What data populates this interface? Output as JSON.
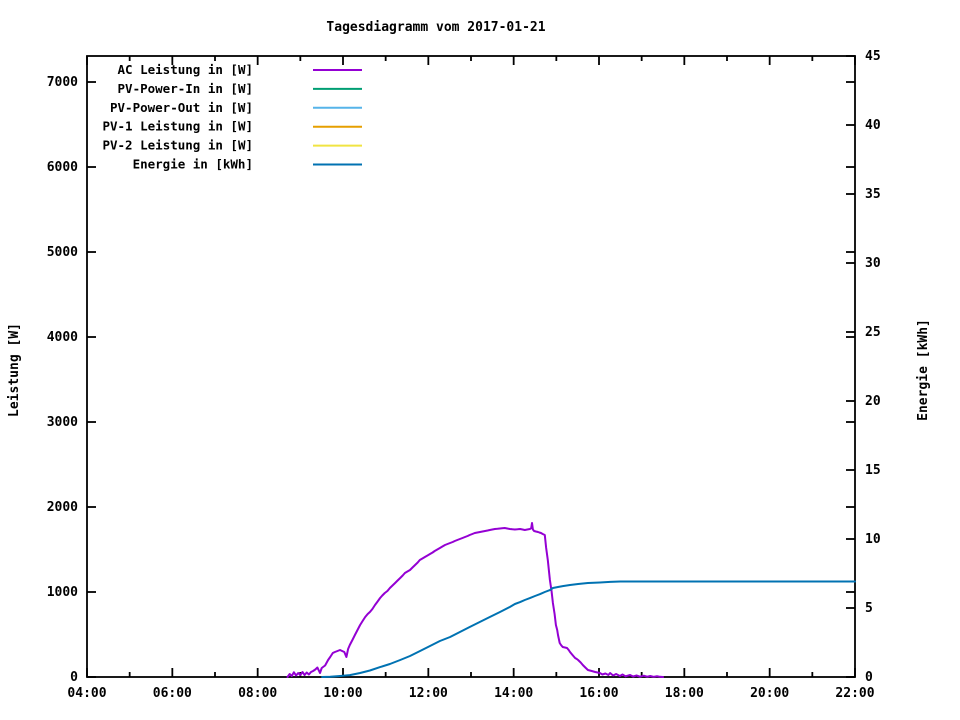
{
  "window": {
    "title": "Tagesdiagramm vom 2017-01-21"
  },
  "colors": {
    "background": "#ffffff",
    "axis": "#000000",
    "text": "#000000"
  },
  "chart_data": {
    "type": "line",
    "title": "Tagesdiagramm vom 2017-01-21",
    "grid": false,
    "legend_position": "top-left-inside",
    "x_axis": {
      "label": "",
      "range_hours": [
        4,
        22
      ],
      "major_tick_hours": [
        4,
        6,
        8,
        10,
        12,
        14,
        16,
        18,
        20,
        22
      ],
      "major_tick_labels": [
        "04:00",
        "06:00",
        "08:00",
        "10:00",
        "12:00",
        "14:00",
        "16:00",
        "18:00",
        "20:00",
        "22:00"
      ],
      "minor_tick_hours": [
        5,
        7,
        9,
        11,
        13,
        15,
        17,
        19,
        21
      ]
    },
    "y_left_axis": {
      "label": "Leistung [W]",
      "range": [
        0,
        7306
      ],
      "tick_values": [
        0,
        1000,
        2000,
        3000,
        4000,
        5000,
        6000,
        7000
      ],
      "tick_labels": [
        "0",
        "1000",
        "2000",
        "3000",
        "4000",
        "5000",
        "6000",
        "7000"
      ]
    },
    "y_right_axis": {
      "label": "Energie [kWh]",
      "range": [
        0,
        45
      ],
      "tick_values": [
        0,
        5,
        10,
        15,
        20,
        25,
        30,
        35,
        40,
        45
      ],
      "tick_labels": [
        "0",
        "5",
        "10",
        "15",
        "20",
        "25",
        "30",
        "35",
        "40",
        "45"
      ]
    },
    "series": [
      {
        "name": "AC Leistung in [W]",
        "color": "#9400d3",
        "axis": "left",
        "points": [
          [
            8.7,
            0
          ],
          [
            8.75,
            35
          ],
          [
            8.8,
            12
          ],
          [
            8.85,
            55
          ],
          [
            8.9,
            18
          ],
          [
            8.95,
            47
          ],
          [
            9.0,
            24
          ],
          [
            9.05,
            59
          ],
          [
            9.1,
            24
          ],
          [
            9.15,
            53
          ],
          [
            9.2,
            29
          ],
          [
            9.25,
            59
          ],
          [
            9.3,
            71
          ],
          [
            9.35,
            88
          ],
          [
            9.4,
            112
          ],
          [
            9.46,
            47
          ],
          [
            9.5,
            106
          ],
          [
            9.58,
            135
          ],
          [
            9.65,
            200
          ],
          [
            9.7,
            235
          ],
          [
            9.76,
            282
          ],
          [
            9.81,
            294
          ],
          [
            9.87,
            306
          ],
          [
            9.93,
            318
          ],
          [
            9.98,
            306
          ],
          [
            10.03,
            294
          ],
          [
            10.08,
            235
          ],
          [
            10.12,
            330
          ],
          [
            10.16,
            376
          ],
          [
            10.22,
            435
          ],
          [
            10.28,
            494
          ],
          [
            10.34,
            553
          ],
          [
            10.4,
            612
          ],
          [
            10.46,
            659
          ],
          [
            10.52,
            706
          ],
          [
            10.58,
            741
          ],
          [
            10.63,
            765
          ],
          [
            10.69,
            800
          ],
          [
            10.75,
            847
          ],
          [
            10.81,
            888
          ],
          [
            10.87,
            929
          ],
          [
            10.92,
            959
          ],
          [
            10.98,
            988
          ],
          [
            11.04,
            1012
          ],
          [
            11.1,
            1047
          ],
          [
            11.16,
            1076
          ],
          [
            11.22,
            1106
          ],
          [
            11.28,
            1135
          ],
          [
            11.34,
            1165
          ],
          [
            11.4,
            1194
          ],
          [
            11.45,
            1224
          ],
          [
            11.51,
            1241
          ],
          [
            11.57,
            1259
          ],
          [
            11.63,
            1288
          ],
          [
            11.69,
            1318
          ],
          [
            11.75,
            1347
          ],
          [
            11.8,
            1376
          ],
          [
            11.86,
            1394
          ],
          [
            11.92,
            1412
          ],
          [
            11.98,
            1429
          ],
          [
            12.04,
            1447
          ],
          [
            12.1,
            1465
          ],
          [
            12.15,
            1482
          ],
          [
            12.21,
            1500
          ],
          [
            12.27,
            1518
          ],
          [
            12.33,
            1535
          ],
          [
            12.39,
            1553
          ],
          [
            12.45,
            1565
          ],
          [
            12.51,
            1576
          ],
          [
            12.57,
            1588
          ],
          [
            12.62,
            1600
          ],
          [
            12.68,
            1612
          ],
          [
            12.74,
            1624
          ],
          [
            12.8,
            1635
          ],
          [
            12.86,
            1647
          ],
          [
            12.92,
            1659
          ],
          [
            12.97,
            1671
          ],
          [
            13.03,
            1682
          ],
          [
            13.09,
            1694
          ],
          [
            13.15,
            1700
          ],
          [
            13.21,
            1706
          ],
          [
            13.27,
            1712
          ],
          [
            13.33,
            1718
          ],
          [
            13.39,
            1724
          ],
          [
            13.44,
            1729
          ],
          [
            13.5,
            1735
          ],
          [
            13.56,
            1741
          ],
          [
            13.62,
            1744
          ],
          [
            13.68,
            1747
          ],
          [
            13.73,
            1750
          ],
          [
            13.79,
            1753
          ],
          [
            13.85,
            1747
          ],
          [
            13.91,
            1741
          ],
          [
            13.97,
            1738
          ],
          [
            14.03,
            1735
          ],
          [
            14.09,
            1738
          ],
          [
            14.15,
            1741
          ],
          [
            14.21,
            1735
          ],
          [
            14.26,
            1729
          ],
          [
            14.32,
            1735
          ],
          [
            14.38,
            1741
          ],
          [
            14.41,
            1750
          ],
          [
            14.43,
            1812
          ],
          [
            14.45,
            1735
          ],
          [
            14.48,
            1718
          ],
          [
            14.52,
            1712
          ],
          [
            14.57,
            1706
          ],
          [
            14.6,
            1700
          ],
          [
            14.64,
            1694
          ],
          [
            14.68,
            1682
          ],
          [
            14.73,
            1671
          ],
          [
            14.76,
            1524
          ],
          [
            14.8,
            1376
          ],
          [
            14.85,
            1141
          ],
          [
            14.89,
            1006
          ],
          [
            14.92,
            871
          ],
          [
            14.96,
            741
          ],
          [
            14.99,
            612
          ],
          [
            15.02,
            553
          ],
          [
            15.04,
            494
          ],
          [
            15.08,
            400
          ],
          [
            15.11,
            376
          ],
          [
            15.15,
            353
          ],
          [
            15.2,
            347
          ],
          [
            15.25,
            341
          ],
          [
            15.29,
            318
          ],
          [
            15.32,
            294
          ],
          [
            15.38,
            259
          ],
          [
            15.44,
            224
          ],
          [
            15.48,
            212
          ],
          [
            15.51,
            200
          ],
          [
            15.57,
            171
          ],
          [
            15.62,
            141
          ],
          [
            15.68,
            112
          ],
          [
            15.74,
            82
          ],
          [
            15.83,
            71
          ],
          [
            15.91,
            59
          ],
          [
            16.02,
            47
          ],
          [
            16.08,
            29
          ],
          [
            16.15,
            41
          ],
          [
            16.22,
            24
          ],
          [
            16.26,
            47
          ],
          [
            16.33,
            18
          ],
          [
            16.4,
            35
          ],
          [
            16.49,
            12
          ],
          [
            16.55,
            29
          ],
          [
            16.62,
            8
          ],
          [
            16.73,
            24
          ],
          [
            16.8,
            6
          ],
          [
            16.88,
            18
          ],
          [
            16.96,
            4
          ],
          [
            17.05,
            15
          ],
          [
            17.13,
            4
          ],
          [
            17.2,
            12
          ],
          [
            17.28,
            2
          ],
          [
            17.36,
            9
          ],
          [
            17.43,
            2
          ],
          [
            17.5,
            0
          ]
        ]
      },
      {
        "name": "PV-Power-In in [W]",
        "color": "#009e73",
        "axis": "left",
        "points": []
      },
      {
        "name": "PV-Power-Out in [W]",
        "color": "#56b4e9",
        "axis": "left",
        "points": []
      },
      {
        "name": "PV-1 Leistung in [W]",
        "color": "#e69f00",
        "axis": "left",
        "points": []
      },
      {
        "name": "PV-2 Leistung in [W]",
        "color": "#f0e442",
        "axis": "left",
        "points": []
      },
      {
        "name": "Energie in [kWh]",
        "color": "#0072b2",
        "axis": "right",
        "points": [
          [
            9.51,
            0.0
          ],
          [
            9.7,
            0.02
          ],
          [
            9.93,
            0.07
          ],
          [
            10.16,
            0.14
          ],
          [
            10.4,
            0.29
          ],
          [
            10.63,
            0.47
          ],
          [
            10.87,
            0.72
          ],
          [
            11.1,
            0.94
          ],
          [
            11.34,
            1.23
          ],
          [
            11.57,
            1.52
          ],
          [
            11.8,
            1.88
          ],
          [
            12.04,
            2.25
          ],
          [
            12.27,
            2.61
          ],
          [
            12.51,
            2.9
          ],
          [
            12.74,
            3.26
          ],
          [
            12.97,
            3.62
          ],
          [
            13.21,
            3.99
          ],
          [
            13.44,
            4.35
          ],
          [
            13.68,
            4.71
          ],
          [
            13.91,
            5.07
          ],
          [
            14.03,
            5.29
          ],
          [
            14.15,
            5.43
          ],
          [
            14.26,
            5.58
          ],
          [
            14.38,
            5.72
          ],
          [
            14.5,
            5.87
          ],
          [
            14.62,
            6.01
          ],
          [
            14.73,
            6.16
          ],
          [
            14.85,
            6.3
          ],
          [
            14.92,
            6.45
          ],
          [
            15.04,
            6.52
          ],
          [
            15.15,
            6.59
          ],
          [
            15.32,
            6.67
          ],
          [
            15.51,
            6.74
          ],
          [
            15.74,
            6.81
          ],
          [
            16.02,
            6.85
          ],
          [
            16.26,
            6.89
          ],
          [
            16.5,
            6.92
          ],
          [
            17.0,
            6.92
          ],
          [
            18.0,
            6.92
          ],
          [
            19.0,
            6.92
          ],
          [
            20.0,
            6.92
          ],
          [
            21.0,
            6.92
          ],
          [
            22.0,
            6.92
          ]
        ]
      }
    ],
    "final_energy_kwh": 6.92,
    "peak_ac_power_w": 1812
  }
}
